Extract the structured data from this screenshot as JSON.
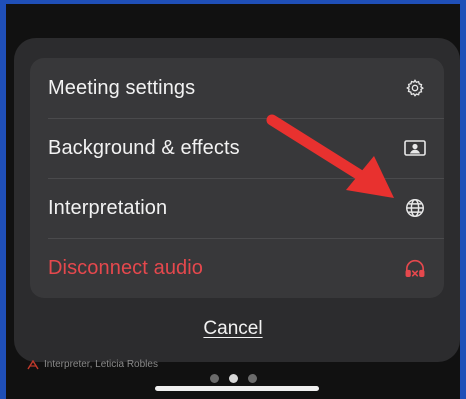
{
  "menu": {
    "items": [
      {
        "label": "Meeting settings",
        "icon": "gear-icon"
      },
      {
        "label": "Background & effects",
        "icon": "portrait-icon"
      },
      {
        "label": "Interpretation",
        "icon": "globe-icon"
      },
      {
        "label": "Disconnect audio",
        "icon": "headphones-disconnect-icon"
      }
    ]
  },
  "cancel_label": "Cancel",
  "background_caption": "Interpreter, Leticia Robles",
  "page_indicator": {
    "count": 3,
    "active_index": 1
  },
  "colors": {
    "sheet": "#2c2c2e",
    "card": "#38383a",
    "text": "#f2f2f2",
    "danger": "#e5484d",
    "annotation_arrow": "#e8312f",
    "frame_accent": "#1f4fb8"
  }
}
